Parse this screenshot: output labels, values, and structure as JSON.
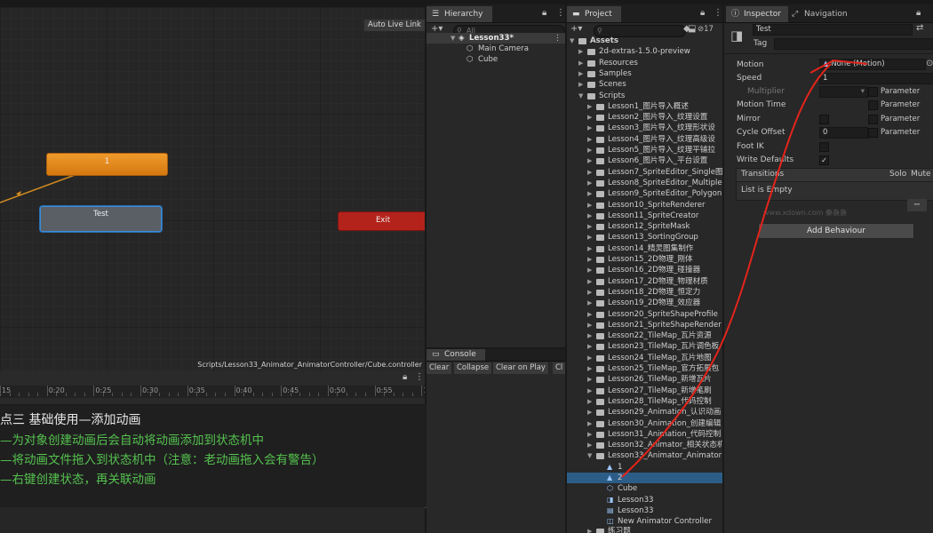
{
  "animator": {
    "auto_live_link": "Auto Live Link",
    "states": {
      "orange": "1",
      "gray": "Test",
      "exit": "Exit"
    },
    "path": "Scripts/Lesson33_Animator_AnimatorController/Cube.controller"
  },
  "timeline": {
    "ticks": [
      "15",
      "0:20",
      "0:25",
      "0:30",
      "0:35",
      "0:40",
      "0:45",
      "0:50",
      "0:55",
      "1:00"
    ]
  },
  "notes": {
    "title": "点三  基础使用—添加动画",
    "lines": [
      "—为对象创建动画后会自动将动画添加到状态机中",
      "—将动画文件拖入到状态机中（注意：老动画拖入会有警告）",
      "—右键创建状态，再关联动画"
    ]
  },
  "hierarchy": {
    "tab": "Hierarchy",
    "search_placeholder": "All",
    "scene": "Lesson33*",
    "items": [
      "Main Camera",
      "Cube"
    ]
  },
  "console": {
    "tab": "Console",
    "buttons": [
      "Clear",
      "Collapse",
      "Clear on Play",
      "Cl"
    ]
  },
  "project": {
    "tab": "Project",
    "badge": "17",
    "assets": "Assets",
    "folders": [
      "2d-extras-1.5.0-preview",
      "Resources",
      "Samples",
      "Scenes",
      "Scripts"
    ],
    "lessons": [
      "Lesson1_图片导入概述",
      "Lesson2_图片导入_纹理设置",
      "Lesson3_图片导入_纹理形状设",
      "Lesson4_图片导入_纹理高级设",
      "Lesson5_图片导入_纹理平铺拉",
      "Lesson6_图片导入_平台设置",
      "Lesson7_SpriteEditor_Single图",
      "Lesson8_SpriteEditor_Multiple",
      "Lesson9_SpriteEditor_Polygon",
      "Lesson10_SpriteRenderer",
      "Lesson11_SpriteCreator",
      "Lesson12_SpriteMask",
      "Lesson13_SortingGroup",
      "Lesson14_精灵图集制作",
      "Lesson15_2D物理_刚体",
      "Lesson16_2D物理_碰撞器",
      "Lesson17_2D物理_物理材质",
      "Lesson18_2D物理_恒定力",
      "Lesson19_2D物理_效应器",
      "Lesson20_SpriteShapeProfile",
      "Lesson21_SpriteShapeRender",
      "Lesson22_TileMap_瓦片资源",
      "Lesson23_TileMap_瓦片调色板",
      "Lesson24_TileMap_瓦片地图",
      "Lesson25_TileMap_官方拓展包",
      "Lesson26_TileMap_新增瓦片",
      "Lesson27_TileMap_新增笔刷",
      "Lesson28_TileMap_代码控制",
      "Lesson29_Animation_认识动画",
      "Lesson30_Animation_创建编辑",
      "Lesson31_Animation_代码控制",
      "Lesson32_Animator_相关状态机",
      "Lesson33_Animator_Animator"
    ],
    "lesson33_children": [
      "1",
      "2",
      "Cube",
      "Lesson33",
      "Lesson33",
      "New Animator Controller"
    ],
    "cut_off": "练习题"
  },
  "inspector": {
    "tab": "Inspector",
    "tab2": "Navigation",
    "name": "Test",
    "tag_label": "Tag",
    "rows": {
      "motion": "Motion",
      "motion_value": "None (Motion)",
      "speed": "Speed",
      "speed_value": "1",
      "multiplier": "Multiplier",
      "motion_time": "Motion Time",
      "mirror": "Mirror",
      "cycle_offset": "Cycle Offset",
      "cycle_offset_value": "0",
      "foot_ik": "Foot IK",
      "write_defaults": "Write Defaults"
    },
    "parameter": "Parameter",
    "transitions": "Transitions",
    "solo": "Solo",
    "mute": "Mute",
    "list_empty": "List is Empty",
    "minus": "−",
    "add_behaviour": "Add Behaviour",
    "watermark": "www.xdown.com 秦袅袅"
  },
  "icons": {
    "lock": "lock-icon",
    "menu": "kebab-menu-icon",
    "plus": "plus-icon",
    "search": "search-icon",
    "folder": "folder-icon",
    "scene": "unity-scene-icon",
    "cube": "cube-icon",
    "anim": "animation-clip-icon"
  },
  "colors": {
    "accent_selection": "#2c5d87",
    "orange_state": "#e58a1f",
    "exit_state": "#b3231b",
    "annotation": "#e2241b",
    "note_green": "#55c24f"
  }
}
